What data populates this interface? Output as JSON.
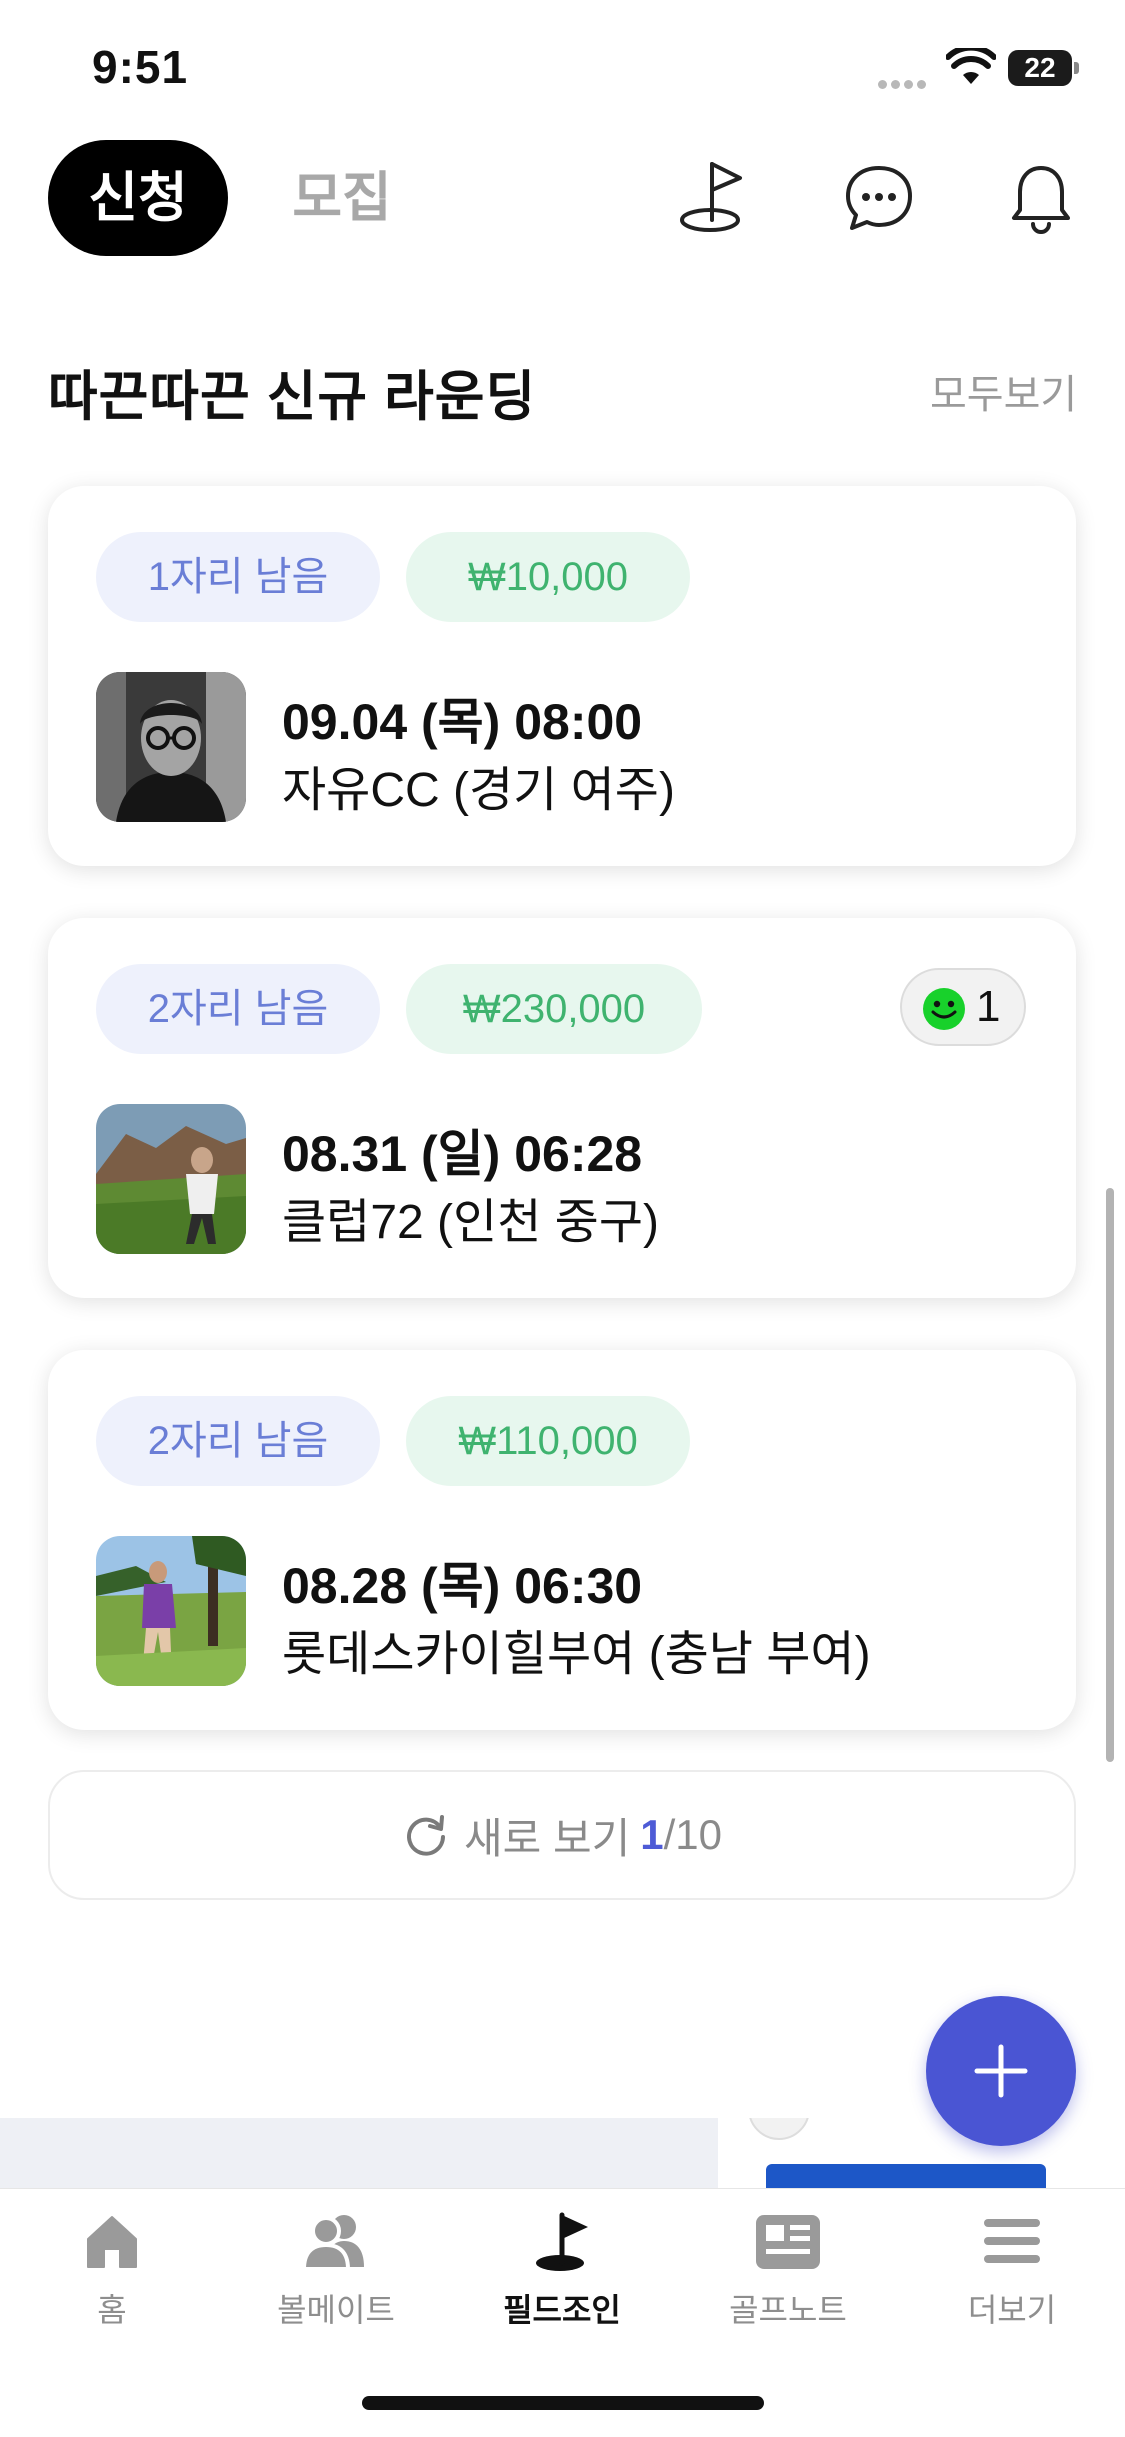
{
  "status_bar": {
    "time": "9:51",
    "battery": "22"
  },
  "header": {
    "tabs": [
      {
        "label": "신청",
        "active": true
      },
      {
        "label": "모집",
        "active": false
      }
    ],
    "icons": [
      "golf-flag-icon",
      "chat-icon",
      "bell-icon"
    ]
  },
  "section": {
    "title": "따끈따끈 신규 라운딩",
    "see_all": "모두보기"
  },
  "rounds": [
    {
      "seats": "1자리 남음",
      "price": "₩10,000",
      "datetime": "09.04 (목) 08:00",
      "location": "자유CC (경기 여주)"
    },
    {
      "seats": "2자리 남음",
      "price": "₩230,000",
      "datetime": "08.31 (일) 06:28",
      "location": "클럽72 (인천 중구)",
      "reaction": {
        "icon": "smile-icon",
        "count": "1"
      }
    },
    {
      "seats": "2자리 남음",
      "price": "₩110,000",
      "datetime": "08.28 (목) 06:30",
      "location": "롯데스카이힐부여 (충남 부여)"
    }
  ],
  "refresh": {
    "label": "새로 보기",
    "current": "1",
    "separator": "/",
    "total": "10"
  },
  "bottom_nav": {
    "items": [
      {
        "label": "홈",
        "icon": "home-icon",
        "active": false
      },
      {
        "label": "볼메이트",
        "icon": "people-icon",
        "active": false
      },
      {
        "label": "필드조인",
        "icon": "golf-flag-icon",
        "active": true
      },
      {
        "label": "골프노트",
        "icon": "note-icon",
        "active": false
      },
      {
        "label": "더보기",
        "icon": "menu-icon",
        "active": false
      }
    ]
  },
  "colors": {
    "accent": "#4a55d3",
    "seat_chip_text": "#6a7ed6",
    "price_chip_text": "#3fb36f"
  }
}
